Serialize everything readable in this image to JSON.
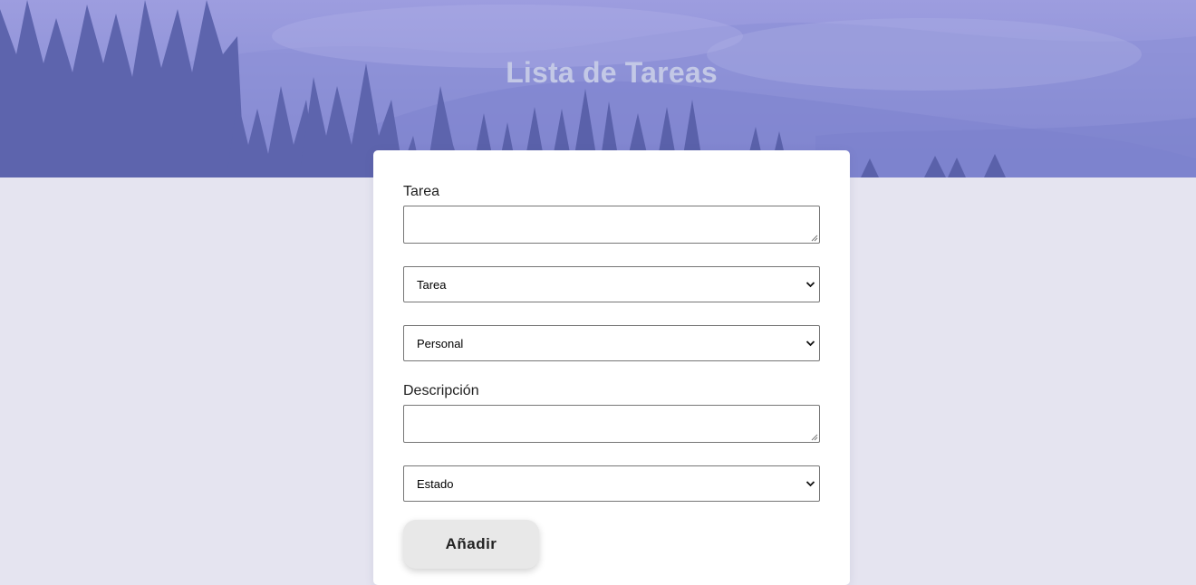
{
  "header": {
    "title": "Lista de Tareas"
  },
  "form": {
    "task_label": "Tarea",
    "task_value": "",
    "type_select": {
      "selected": "Tarea"
    },
    "category_select": {
      "selected": "Personal"
    },
    "description_label": "Descripción",
    "description_value": "",
    "status_select": {
      "selected": "Estado"
    },
    "submit_label": "Añadir"
  },
  "colors": {
    "page_background": "#e5e4f0",
    "hero_tint": "#8f93d8",
    "card": "#ffffff",
    "button": "#e8e8e8"
  }
}
